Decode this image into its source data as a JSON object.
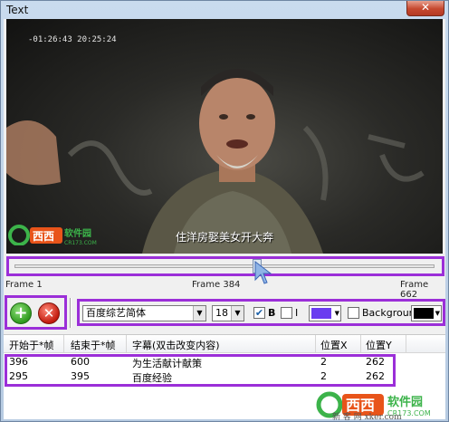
{
  "window": {
    "title": "Text",
    "close_glyph": "✕"
  },
  "video": {
    "timecode": "-01:26:43  20:25:24",
    "subtitle_text": "住洋房娶美女开大奔",
    "logo_text": "西西",
    "logo_subtext": "软件园",
    "logo_url": "CR173.COM"
  },
  "slider": {
    "position_fraction": 0.58,
    "frame_start_label": "Frame 1",
    "frame_current_label": "Frame 384",
    "frame_end_label": "Frame 662"
  },
  "toolbar": {
    "add_glyph": "+",
    "delete_glyph": "✕",
    "font_value": "百度综艺简体",
    "size_value": "18",
    "bold_checked": true,
    "bold_label": "B",
    "italic_checked": false,
    "italic_label": "I",
    "text_color": "#6a3cf0",
    "background_checked": false,
    "background_label": "Background:",
    "background_color": "#000000",
    "dropdown_glyph": "▼"
  },
  "table": {
    "columns": [
      "开始于*帧",
      "结束于*帧",
      "字幕(双击改变内容)",
      "位置X",
      "位置Y"
    ],
    "rows": [
      [
        "396",
        "600",
        "为生活献计献策",
        "2",
        "262"
      ],
      [
        "295",
        "395",
        "百度经验",
        "2",
        "262"
      ]
    ]
  },
  "watermark": {
    "site": "新 客 网  xker.com"
  },
  "colors": {
    "accent_highlight": "#9b2fd8"
  }
}
